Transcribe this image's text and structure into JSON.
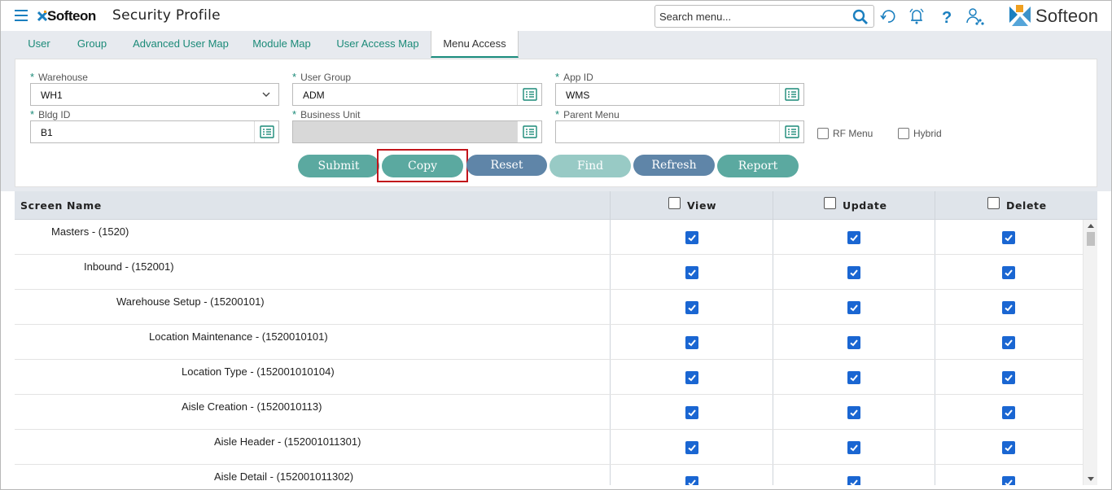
{
  "header": {
    "logo_text": "Softeon",
    "page_title": "Security Profile",
    "search_placeholder": "Search menu...",
    "brand_name": "Softeon"
  },
  "tabs": [
    {
      "label": "User"
    },
    {
      "label": "Group"
    },
    {
      "label": "Advanced User Map"
    },
    {
      "label": "Module Map"
    },
    {
      "label": "User Access Map"
    },
    {
      "label": "Menu Access",
      "active": true
    }
  ],
  "form": {
    "required_mark": "*",
    "warehouse": {
      "label": "Warehouse",
      "value": "WH1"
    },
    "user_group": {
      "label": "User Group",
      "value": "ADM"
    },
    "app_id": {
      "label": "App ID",
      "value": "WMS"
    },
    "bldg_id": {
      "label": "Bldg ID",
      "value": "B1"
    },
    "business_unit": {
      "label": "Business Unit",
      "value": ""
    },
    "parent_menu": {
      "label": "Parent Menu",
      "value": ""
    },
    "rf_menu": {
      "label": "RF Menu",
      "checked": false
    },
    "hybrid": {
      "label": "Hybrid",
      "checked": false
    }
  },
  "buttons": {
    "submit": "Submit",
    "copy": "Copy",
    "reset": "Reset",
    "find": "Find",
    "refresh": "Refresh",
    "report": "Report"
  },
  "grid": {
    "columns": {
      "screen_name": "Screen Name",
      "view": "View",
      "update": "Update",
      "delete": "Delete"
    },
    "rows": [
      {
        "name": "Masters - (1520)",
        "level": 0,
        "view": true,
        "update": true,
        "delete": true
      },
      {
        "name": "Inbound - (152001)",
        "level": 1,
        "view": true,
        "update": true,
        "delete": true
      },
      {
        "name": "Warehouse Setup - (15200101)",
        "level": 2,
        "view": true,
        "update": true,
        "delete": true
      },
      {
        "name": "Location Maintenance - (1520010101)",
        "level": 3,
        "view": true,
        "update": true,
        "delete": true
      },
      {
        "name": "Location Type - (152001010104)",
        "level": 4,
        "view": true,
        "update": true,
        "delete": true
      },
      {
        "name": "Aisle Creation - (1520010113)",
        "level": 4,
        "view": true,
        "update": true,
        "delete": true
      },
      {
        "name": "Aisle Header - (152001011301)",
        "level": 5,
        "view": true,
        "update": true,
        "delete": true
      },
      {
        "name": "Aisle Detail - (152001011302)",
        "level": 5,
        "view": true,
        "update": true,
        "delete": true
      }
    ]
  },
  "colors": {
    "accent_teal": "#1b8a78",
    "button_teal": "#5ba9a0",
    "button_blue": "#5f85a8",
    "checkbox_blue": "#1a66d2",
    "highlight_red": "#c2141b"
  }
}
